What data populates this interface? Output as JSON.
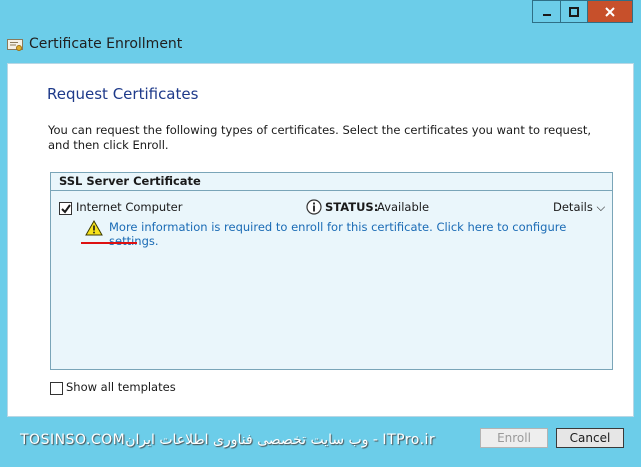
{
  "window": {
    "title": "Certificate Enrollment",
    "min_label": "‒",
    "max_label": "□",
    "close_label": "✕"
  },
  "page": {
    "heading": "Request Certificates",
    "description": "You can request the following types of certificates. Select the certificates you want to request, and then click Enroll."
  },
  "cert_group": {
    "name": "SSL Server Certificate",
    "item": {
      "label": "Internet Computer",
      "checked": true,
      "status_label": "STATUS:",
      "status_value": "Available",
      "details_label": "Details ⌵",
      "warning_link": "More information is required to enroll for this certificate. Click here to configure settings."
    }
  },
  "show_all": {
    "label": "Show all templates",
    "checked": false
  },
  "buttons": {
    "enroll": "Enroll",
    "cancel": "Cancel"
  },
  "watermark": "TOSINSO.COMوب سایت تخصصی فناوری اطلاعات ایران - ITPro.ir",
  "colors": {
    "background": "#6ccde9",
    "heading": "#1e3a8a",
    "link": "#1a6bb5",
    "close": "#c7502b"
  }
}
